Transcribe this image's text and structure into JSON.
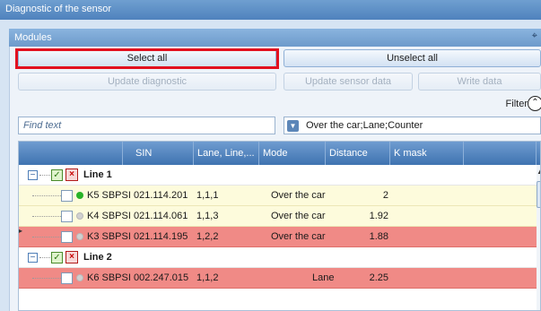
{
  "window": {
    "title": "Diagnostic of the sensor"
  },
  "panel": {
    "title": "Modules"
  },
  "buttons": {
    "select_all": "Select all",
    "unselect_all": "Unselect all",
    "update_diagnostic": "Update diagnostic",
    "update_sensor_data": "Update sensor data",
    "write_data": "Write data"
  },
  "filter": {
    "label": "Filter"
  },
  "search": {
    "placeholder": "Find text"
  },
  "combo": {
    "value": "Over the car;Lane;Counter"
  },
  "columns": [
    "SIN",
    "Lane, Line,...",
    "Mode",
    "Distance",
    "K mask"
  ],
  "groups": [
    {
      "name": "Line 1",
      "items": [
        {
          "sin": "K5 SBPSI 021.114.201",
          "lane": "1,1,1",
          "mode": "Over the car",
          "distance": "2",
          "status": "on",
          "highlight": "yellow"
        },
        {
          "sin": "K4 SBPSI 021.114.061",
          "lane": "1,1,3",
          "mode": "Over the car",
          "distance": "1.92",
          "status": "off",
          "highlight": "yellow"
        },
        {
          "sin": "K3 SBPSI 021.114.195",
          "lane": "1,2,2",
          "mode": "Over the car",
          "distance": "1.88",
          "status": "off",
          "highlight": "red"
        }
      ]
    },
    {
      "name": "Line 2",
      "items": [
        {
          "sin": "K6 SBPSI 002.247.015",
          "lane": "1,1,2",
          "mode": "Lane",
          "distance": "2.25",
          "status": "off",
          "highlight": "red"
        }
      ]
    }
  ],
  "colors": {
    "title_bar": "#4f82bd",
    "header_bar": "#3f73b0",
    "highlight_border": "#e2101f",
    "row_yellow": "#fdfbdc",
    "row_red": "#f08a86",
    "status_on": "#28b328",
    "status_off": "#d0d0d0"
  },
  "icons": {
    "collapse": "minus-icon",
    "checked": "checkmark-icon",
    "disabled": "red-x-icon",
    "status_on": "green-dot-icon",
    "status_off": "gray-dot-icon",
    "filter_toggle": "chevron-up-icon",
    "combo_dropdown": "triangle-down-icon"
  }
}
